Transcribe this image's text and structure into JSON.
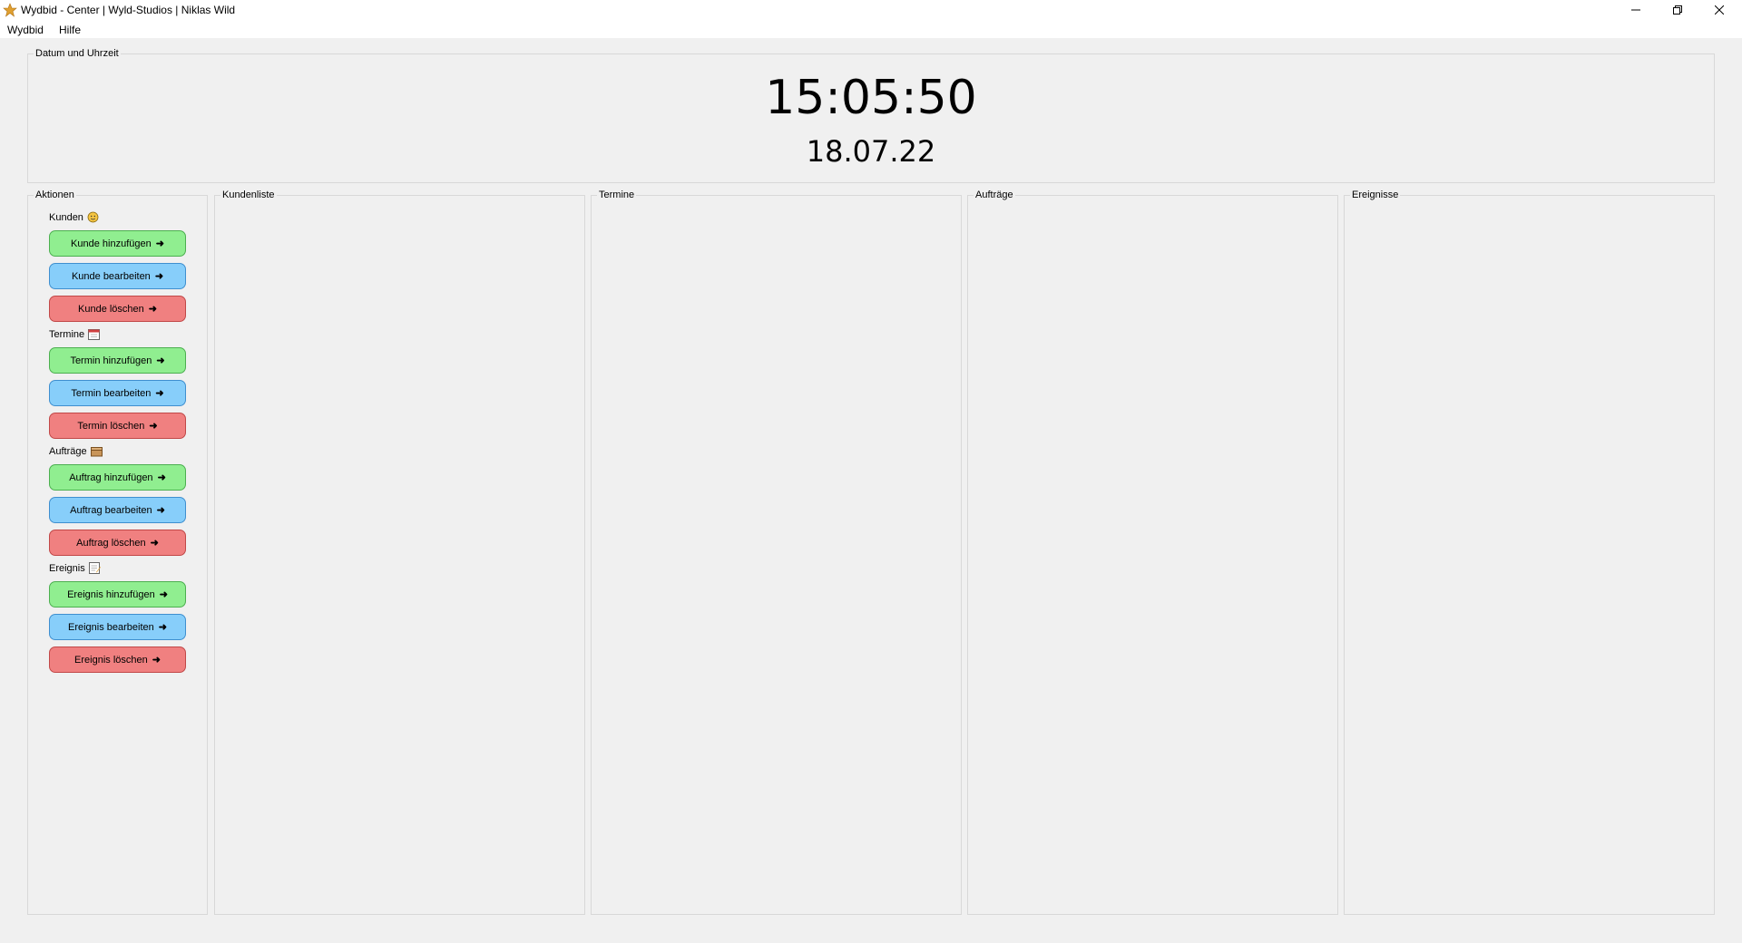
{
  "window": {
    "title": "Wydbid - Center | Wyld-Studios | Niklas Wild",
    "app_icon": "star-logo-icon"
  },
  "menu": [
    "Wydbid",
    "Hilfe"
  ],
  "datetime": {
    "group_title": "Datum und Uhrzeit",
    "time": "15:05:50",
    "date": "18.07.22"
  },
  "actions": {
    "group_title": "Aktionen",
    "sections": [
      {
        "label": "Kunden",
        "icon": "person-face-icon",
        "buttons": [
          {
            "label": "Kunde hinzufügen",
            "kind": "add"
          },
          {
            "label": "Kunde bearbeiten",
            "kind": "edit"
          },
          {
            "label": "Kunde löschen",
            "kind": "delete"
          }
        ]
      },
      {
        "label": "Termine",
        "icon": "calendar-icon",
        "buttons": [
          {
            "label": "Termin hinzufügen",
            "kind": "add"
          },
          {
            "label": "Termin bearbeiten",
            "kind": "edit"
          },
          {
            "label": "Termin löschen",
            "kind": "delete"
          }
        ]
      },
      {
        "label": "Aufträge",
        "icon": "package-icon",
        "buttons": [
          {
            "label": "Auftrag hinzufügen",
            "kind": "add"
          },
          {
            "label": "Auftrag bearbeiten",
            "kind": "edit"
          },
          {
            "label": "Auftrag löschen",
            "kind": "delete"
          }
        ]
      },
      {
        "label": "Ereignis",
        "icon": "notepad-icon",
        "buttons": [
          {
            "label": "Ereignis hinzufügen",
            "kind": "add"
          },
          {
            "label": "Ereignis bearbeiten",
            "kind": "edit"
          },
          {
            "label": "Ereignis löschen",
            "kind": "delete"
          }
        ]
      }
    ],
    "arrow": "➜"
  },
  "panels": [
    "Kundenliste",
    "Termine",
    "Aufträge",
    "Ereignisse"
  ],
  "colors": {
    "add": "#90ee90",
    "edit": "#87cefa",
    "delete": "#f08080"
  }
}
